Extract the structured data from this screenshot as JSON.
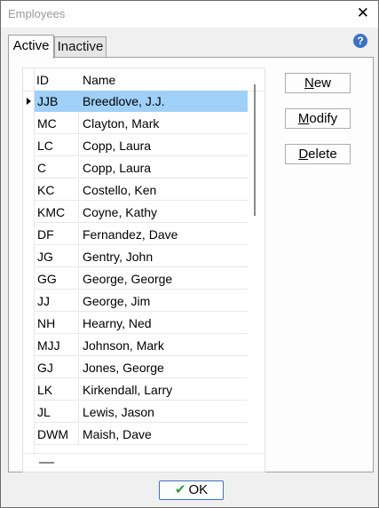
{
  "window": {
    "title": "Employees",
    "close_glyph": "✕"
  },
  "tabs": [
    {
      "label": "Active",
      "selected": true
    },
    {
      "label": "Inactive",
      "selected": false
    }
  ],
  "help_glyph": "?",
  "grid": {
    "columns": [
      "ID",
      "Name"
    ],
    "selected_index": 0,
    "rows": [
      {
        "id": "JJB",
        "name": "Breedlove, J.J."
      },
      {
        "id": "MC",
        "name": "Clayton, Mark"
      },
      {
        "id": "LC",
        "name": "Copp, Laura"
      },
      {
        "id": "C",
        "name": "Copp, Laura"
      },
      {
        "id": "KC",
        "name": "Costello, Ken"
      },
      {
        "id": "KMC",
        "name": "Coyne, Kathy"
      },
      {
        "id": "DF",
        "name": "Fernandez, Dave"
      },
      {
        "id": "JG",
        "name": "Gentry, John"
      },
      {
        "id": "GG",
        "name": "George, George"
      },
      {
        "id": "JJ",
        "name": "George, Jim"
      },
      {
        "id": "NH",
        "name": "Hearny, Ned"
      },
      {
        "id": "MJJ",
        "name": "Johnson, Mark"
      },
      {
        "id": "GJ",
        "name": "Jones, George"
      },
      {
        "id": "LK",
        "name": "Kirkendall, Larry"
      },
      {
        "id": "JL",
        "name": "Lewis, Jason"
      },
      {
        "id": "DWM",
        "name": "Maish, Dave"
      }
    ]
  },
  "buttons": {
    "new": {
      "first": "N",
      "rest": "ew"
    },
    "modify": {
      "first": "M",
      "rest": "odify"
    },
    "delete": {
      "first": "D",
      "rest": "elete"
    },
    "ok": {
      "check": "✔",
      "label": "OK"
    }
  },
  "colors": {
    "selection": "#9fd0f7",
    "help": "#3a73c4",
    "ok_check": "#2f9d3a"
  }
}
